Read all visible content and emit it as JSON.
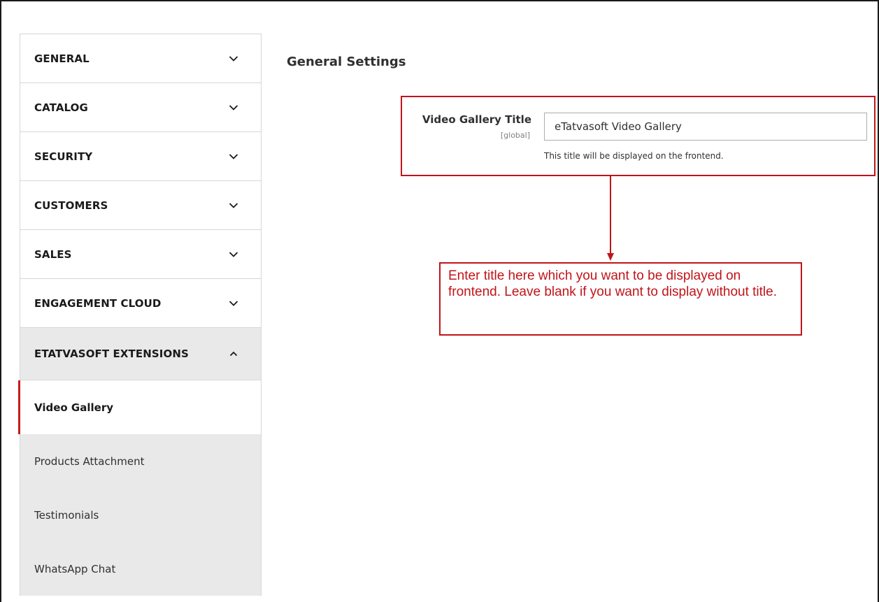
{
  "sidebar": {
    "sections": [
      {
        "label": "GENERAL",
        "expanded": false
      },
      {
        "label": "CATALOG",
        "expanded": false
      },
      {
        "label": "SECURITY",
        "expanded": false
      },
      {
        "label": "CUSTOMERS",
        "expanded": false
      },
      {
        "label": "SALES",
        "expanded": false
      },
      {
        "label": "ENGAGEMENT CLOUD",
        "expanded": false
      },
      {
        "label": "ETATVASOFT EXTENSIONS",
        "expanded": true
      }
    ],
    "sub_items": [
      {
        "label": "Video Gallery",
        "active": true
      },
      {
        "label": "Products Attachment",
        "active": false
      },
      {
        "label": "Testimonials",
        "active": false
      },
      {
        "label": "WhatsApp Chat",
        "active": false
      }
    ]
  },
  "main": {
    "title": "General Settings",
    "field": {
      "label": "Video Gallery Title",
      "scope": "[global]",
      "value": "eTatvasoft Video Gallery",
      "note": "This title will be displayed on the frontend."
    },
    "callout": "Enter title here which you want to be displayed on frontend. Leave blank if you want to display without title."
  },
  "colors": {
    "accent": "#c0141a",
    "active_border": "#c71b1b",
    "sidebar_open_bg": "#e9e9e9"
  },
  "icons": {
    "collapsed": "chevron-down-icon",
    "expanded": "chevron-up-icon"
  }
}
